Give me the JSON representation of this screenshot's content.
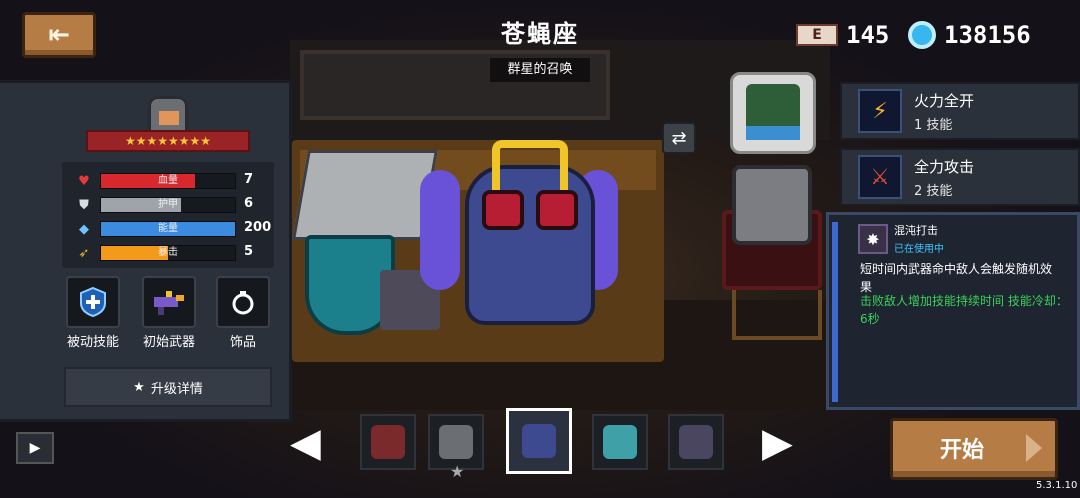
{
  "header": {
    "title": "苍蝇座",
    "subtitle": "群星的召唤",
    "back_icon": "exit-door-icon"
  },
  "currency": {
    "gems": "145",
    "gem_icon_text": "E",
    "coins": "138156"
  },
  "character_panel": {
    "stars": "★★★★★★★★",
    "stats": [
      {
        "name": "血量",
        "value": "7",
        "fill": 0.7,
        "color": "#d8282e",
        "icon": "♥"
      },
      {
        "name": "护甲",
        "value": "6",
        "fill": 0.6,
        "color": "#9ea4aa",
        "icon": "⛊"
      },
      {
        "name": "能量",
        "value": "200",
        "fill": 1.0,
        "color": "#3b8be0",
        "icon": "◆"
      },
      {
        "name": "暴击",
        "value": "5",
        "fill": 0.5,
        "color": "#f39a1a",
        "icon": "➶"
      }
    ],
    "slots": [
      {
        "label": "被动技能",
        "icon": "shield-plus-icon"
      },
      {
        "label": "初始武器",
        "icon": "blaster-gun-icon"
      },
      {
        "label": "饰品",
        "icon": "ring-icon"
      }
    ],
    "upgrade_label": "升级详情",
    "upgrade_icon": "★"
  },
  "skills": [
    {
      "title": "火力全开",
      "sub": "1 技能",
      "icon": "ammo-icon",
      "glyph": "⚡"
    },
    {
      "title": "全力攻击",
      "sub": "2 技能",
      "icon": "crossed-swords-icon",
      "glyph": "⚔"
    }
  ],
  "description": {
    "name": "混沌打击",
    "status": "已在使用中",
    "text": "短时间内武器命中敌人会触发随机效果",
    "green": "击败敌人增加技能持续时间 技能冷却：6秒"
  },
  "character_selector": {
    "prev": "◀",
    "next": "▶",
    "characters": [
      {
        "name": "knight-dark",
        "color": "#7a2a2a"
      },
      {
        "name": "knight-grey",
        "color": "#6b6e72"
      },
      {
        "name": "fly-lord",
        "color": "#3e4a8f"
      },
      {
        "name": "portrait",
        "color": "#3fa0a8"
      },
      {
        "name": "wizard",
        "color": "#4a4660"
      }
    ],
    "selected_index": 2
  },
  "start_button": "开始",
  "swap_glyph": "⇄",
  "video_glyph": "▶",
  "version": "5.3.1.10"
}
